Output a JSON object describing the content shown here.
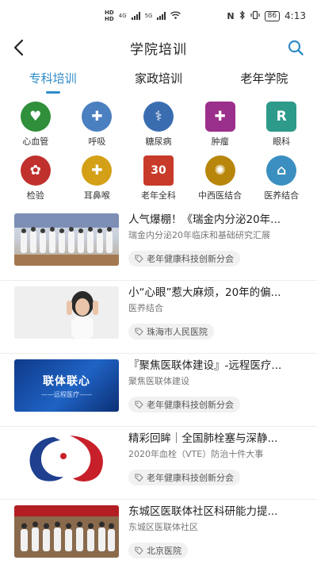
{
  "status_bar": {
    "hd_top": "HD",
    "hd_bottom": "HD",
    "network_1": "4G",
    "network_2": "5G",
    "battery": "86",
    "time": "4:13"
  },
  "header": {
    "title": "学院培训"
  },
  "tabs": [
    {
      "label": "专科培训",
      "active": true
    },
    {
      "label": "家政培训",
      "active": false
    },
    {
      "label": "老年学院",
      "active": false
    }
  ],
  "categories": [
    {
      "label": "心血管",
      "icon": "heart-icon",
      "glyph": "♥",
      "color": "#2f8f3a"
    },
    {
      "label": "呼吸",
      "icon": "lungs-icon",
      "glyph": "✚",
      "color": "#4a7fc0"
    },
    {
      "label": "糖尿病",
      "icon": "diabetes-icon",
      "glyph": "⚕",
      "color": "#3a6db0"
    },
    {
      "label": "肿瘤",
      "icon": "oncology-icon",
      "glyph": "✚",
      "color": "#9b2f8c"
    },
    {
      "label": "眼科",
      "icon": "eye-icon",
      "glyph": "R",
      "color": "#2e9a8a"
    },
    {
      "label": "检验",
      "icon": "lab-icon",
      "glyph": "✿",
      "color": "#c0302c"
    },
    {
      "label": "耳鼻喉",
      "icon": "ent-icon",
      "glyph": "✚",
      "color": "#d4a017"
    },
    {
      "label": "老年全科",
      "icon": "geriatric-icon",
      "glyph": "30",
      "color": "#c83a2a"
    },
    {
      "label": "中西医结合",
      "icon": "tcm-icon",
      "glyph": "✺",
      "color": "#b8860b"
    },
    {
      "label": "医养结合",
      "icon": "elderly-care-icon",
      "glyph": "⌂",
      "color": "#3a8fc0"
    }
  ],
  "news": [
    {
      "title": "人气爆棚！《瑞金内分泌20年...",
      "subtitle": "瑞金内分泌20年临床和基础研究汇展",
      "tag": "老年健康科技创新分会",
      "thumb": "group-photo"
    },
    {
      "title": "小“心眼”惹大麻烦，20年的偏...",
      "subtitle": "医养结合",
      "tag": "珠海市人民医院",
      "thumb": "headache"
    },
    {
      "title": "『聚焦医联体建设』-远程医疗...",
      "subtitle": "聚焦医联体建设",
      "tag": "老年健康科技创新分会",
      "thumb": "banner"
    },
    {
      "title": "精彩回眸｜全国肺栓塞与深静...",
      "subtitle": "2020年血栓（VTE）防治十件大事",
      "tag": "老年健康科技创新分会",
      "thumb": "logo"
    },
    {
      "title": "东城区医联体社区科研能力提...",
      "subtitle": "东城区医联体社区",
      "tag": "北京医院",
      "thumb": "group-photo-2"
    }
  ],
  "thumb_text": {
    "banner_line1": "联体联心",
    "banner_line2": "——远程医疗——"
  },
  "colors": {
    "accent": "#2e8bc9",
    "tag_bg": "#f1f1f1"
  }
}
